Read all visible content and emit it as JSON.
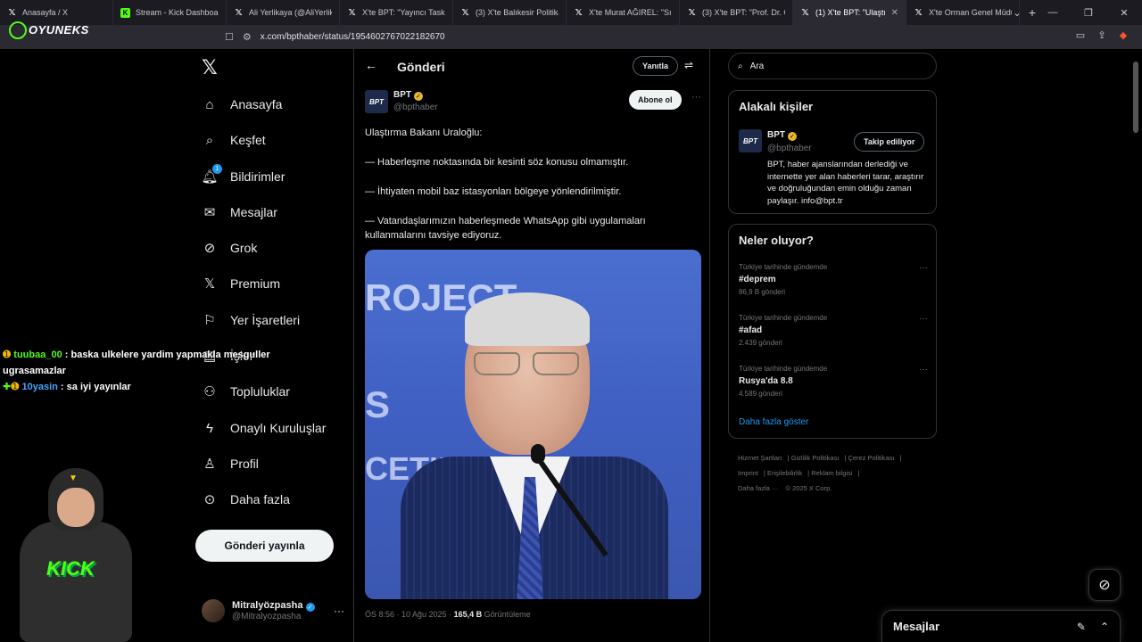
{
  "tabs": [
    {
      "label": "Anasayfa / X",
      "icon": "x-icon",
      "active": false
    },
    {
      "label": "Stream - Kick Dashboard",
      "icon": "kick-icon",
      "active": false
    },
    {
      "label": "Ali Yerlikaya (@AliYerlikaya",
      "icon": "x-icon",
      "active": false
    },
    {
      "label": "X'te BPT: \"Yayıncı Taskınefe",
      "icon": "x-icon",
      "active": false
    },
    {
      "label": "(3) X'te Balıkesir Politika G",
      "icon": "x-icon",
      "active": false
    },
    {
      "label": "X'te Murat AĞIREL: \"Sındı",
      "icon": "x-icon",
      "active": false
    },
    {
      "label": "(3) X'te BPT: \"Prof. Dr. Öve",
      "icon": "x-icon",
      "active": false
    },
    {
      "label": "(1) X'te BPT: \"Ulaştırm",
      "icon": "x-icon",
      "active": true
    },
    {
      "label": "X'te Orman Genel Müdürl",
      "icon": "x-icon",
      "active": false
    }
  ],
  "overlay_logo": "OYUNEKS",
  "url": "x.com/bpthaber/status/1954602767022182670",
  "nav": {
    "items": [
      {
        "label": "Anasayfa",
        "icon": "home-icon"
      },
      {
        "label": "Keşfet",
        "icon": "search-icon"
      },
      {
        "label": "Bildirimler",
        "icon": "bell-icon",
        "badge": "1"
      },
      {
        "label": "Mesajlar",
        "icon": "mail-icon"
      },
      {
        "label": "Grok",
        "icon": "grok-icon"
      },
      {
        "label": "Premium",
        "icon": "x-icon"
      },
      {
        "label": "Yer İşaretleri",
        "icon": "bookmark-icon"
      },
      {
        "label": "İşler",
        "icon": "briefcase-icon"
      },
      {
        "label": "Topluluklar",
        "icon": "people-icon"
      },
      {
        "label": "Onaylı Kuruluşlar",
        "icon": "lightning-icon"
      },
      {
        "label": "Profil",
        "icon": "person-icon"
      },
      {
        "label": "Daha fazla",
        "icon": "more-circle-icon"
      }
    ],
    "post_button": "Gönderi yayınla",
    "account": {
      "name": "Mitralyözpasha",
      "handle": "@Mitralyozpasha"
    }
  },
  "main": {
    "title": "Gönderi",
    "reply_button": "Yanıtla",
    "author": {
      "name": "BPT",
      "handle": "@bpthaber",
      "avatar_text": "BPT"
    },
    "subscribe_button": "Abone ol",
    "text": [
      "Ulaştırma Bakanı Uraloğlu:",
      "— Haberleşme noktasında bir kesinti söz konusu olmamıştır.",
      "— İhtiyaten mobil baz istasyonları bölgeye yönlendirilmiştir.",
      "— Vatandaşlarımızın haberleşmede WhatsApp gibi uygulamaları kullanmalarını tavsiye ediyoruz."
    ],
    "photo_text": {
      "line1": "ROJECT",
      "line2": "S",
      "line3": "CETIN"
    },
    "meta": {
      "time": "ÖS 8:56 · 10 Ağu 2025 · ",
      "views": "165,4 B",
      "views_label": " Görüntüleme"
    }
  },
  "right": {
    "search_placeholder": "Ara",
    "related": {
      "title": "Alakalı kişiler",
      "name": "BPT",
      "handle": "@bpthaber",
      "follow_button": "Takip ediliyor",
      "bio": "BPT, haber ajanslarından derlediği ve internette yer alan haberleri tarar, araştırır ve doğruluğundan emin olduğu zaman paylaşır. info@bpt.tr"
    },
    "trends": {
      "title": "Neler oluyor?",
      "items": [
        {
          "context": "Türkiye tarihinde gündemde",
          "tag": "#deprem",
          "count": "86,9 B gönderi"
        },
        {
          "context": "Türkiye tarihinde gündemde",
          "tag": "#afad",
          "count": "2.439 gönderi"
        },
        {
          "context": "Türkiye tarihinde gündemde",
          "tag": "Rusya'da 8.8",
          "count": "4.589 gönderi"
        }
      ],
      "show_more": "Daha fazla göster"
    },
    "footer": [
      "Hizmet Şartları",
      "Gizlilik Politikası",
      "Çerez Politikası",
      "Imprint",
      "Erişilebilirlik",
      "Reklam bilgisi",
      "Daha fazla ···",
      "© 2025 X Corp."
    ]
  },
  "messages_drawer": {
    "title": "Mesajlar"
  },
  "chat": [
    {
      "user": "tuubaa_00",
      "message": " : baska ulkelere yardim yapmakla mesguller ugrasamazlar"
    },
    {
      "user": "10yasin",
      "message": " : sa iyi yayınlar"
    }
  ],
  "streamer_overlay_text": "KICK",
  "colors": {
    "accent": "#1d9bf0",
    "kick": "#53fc18",
    "verified_gold": "#e8b52f"
  }
}
